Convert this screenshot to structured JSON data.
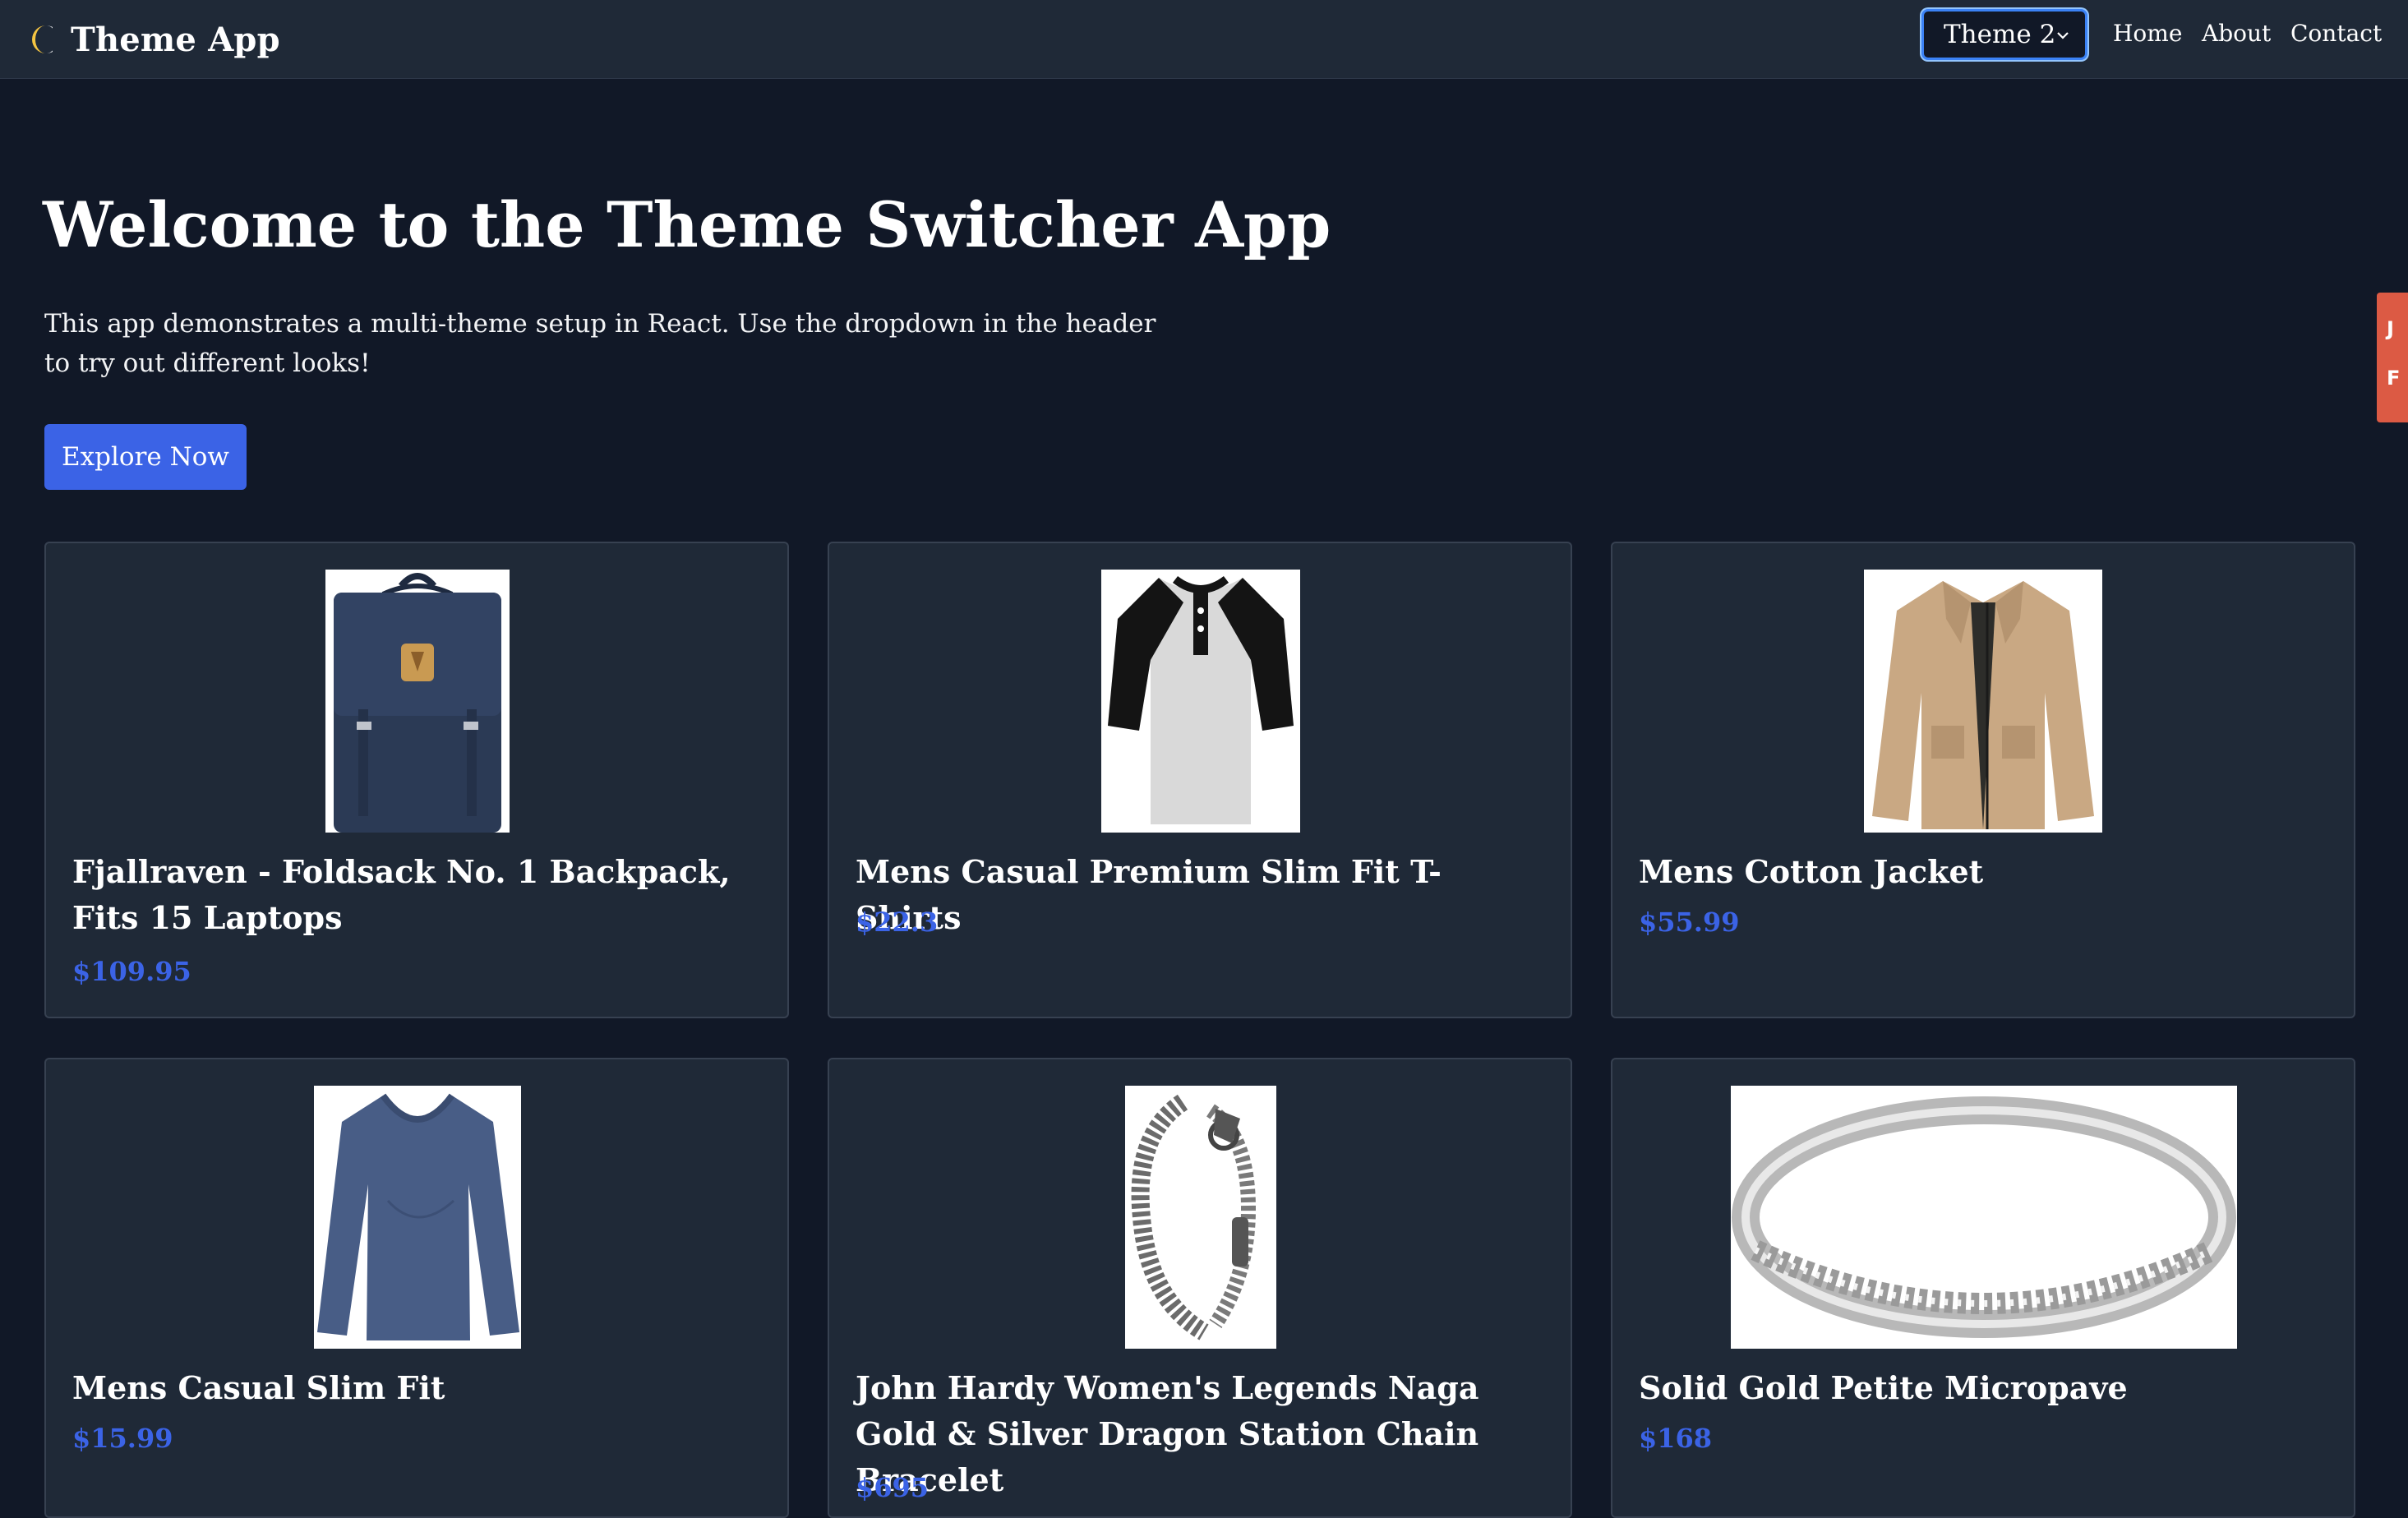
{
  "header": {
    "brand_title": "Theme App",
    "theme_select": {
      "selected": "Theme 2"
    },
    "nav": [
      {
        "label": "Home"
      },
      {
        "label": "About"
      },
      {
        "label": "Contact"
      }
    ]
  },
  "hero": {
    "title": "Welcome to the Theme Switcher App",
    "description": "This app demonstrates a multi-theme setup in React. Use the dropdown in the header to try out different looks!",
    "cta_label": "Explore Now"
  },
  "side_tab": {
    "letters": [
      "J",
      "F"
    ]
  },
  "products": [
    {
      "title": "Fjallraven - Foldsack No. 1 Backpack, Fits 15 Laptops",
      "price": "$109.95",
      "image": "backpack"
    },
    {
      "title": "Mens Casual Premium Slim Fit T-Shirts",
      "price": "$22.3",
      "image": "raglan-tshirt"
    },
    {
      "title": "Mens Cotton Jacket",
      "price": "$55.99",
      "image": "jacket"
    },
    {
      "title": "Mens Casual Slim Fit",
      "price": "$15.99",
      "image": "longsleeve-shirt"
    },
    {
      "title": "John Hardy Women's Legends Naga Gold & Silver Dragon Station Chain Bracelet",
      "price": "$695",
      "image": "chain-bracelet"
    },
    {
      "title": "Solid Gold Petite Micropave",
      "price": "$168",
      "image": "diamond-ring"
    }
  ],
  "colors": {
    "page_bg": "#111827",
    "header_bg": "#1f2937",
    "card_bg": "#1f2937",
    "accent": "#3b63e6",
    "side_tab": "#dc5a44"
  }
}
